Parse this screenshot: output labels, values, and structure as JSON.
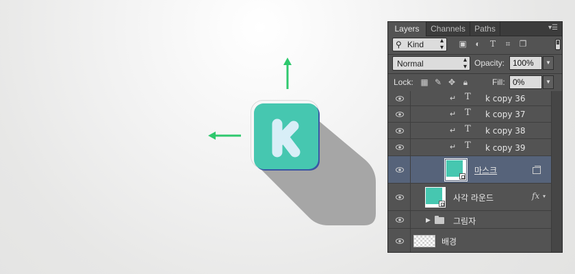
{
  "canvas": {
    "icon_letter": "K",
    "colors": {
      "arrow": "#2ec86d",
      "icon_face": "#46c7b0",
      "icon_letter": "#d8eef7",
      "shadow": "#a6a6a6",
      "icon_rim": "#3a57a4"
    },
    "arrows": [
      "arrow-up-icon",
      "arrow-left-icon"
    ]
  },
  "panel": {
    "tabs": [
      {
        "label": "Layers",
        "active": true
      },
      {
        "label": "Channels",
        "active": false
      },
      {
        "label": "Paths",
        "active": false
      }
    ],
    "menu_icon": "≡",
    "filter": {
      "kind_label": "Kind",
      "icons": [
        "image-filter-icon",
        "adjustment-filter-icon",
        "type-filter-icon",
        "shape-filter-icon",
        "smart-object-filter-icon"
      ]
    },
    "blend": {
      "mode": "Normal",
      "opacity_label": "Opacity:",
      "opacity_value": "100%"
    },
    "lock": {
      "label": "Lock:",
      "icons": [
        "lock-transparent-icon",
        "lock-paint-icon",
        "lock-move-icon",
        "lock-all-icon"
      ],
      "fill_label": "Fill:",
      "fill_value": "0%"
    },
    "layers": [
      {
        "name": "k copy 36",
        "kind": "type",
        "clipped": true
      },
      {
        "name": "k copy 37",
        "kind": "type",
        "clipped": true
      },
      {
        "name": "k copy 38",
        "kind": "type",
        "clipped": true
      },
      {
        "name": "k copy 39",
        "kind": "type",
        "clipped": true
      },
      {
        "name": "마스크",
        "kind": "shape",
        "selected": true
      },
      {
        "name": "사각 라운드",
        "kind": "shape",
        "fx": "fx"
      },
      {
        "name": "그림자",
        "kind": "group"
      },
      {
        "name": "배경",
        "kind": "background"
      }
    ],
    "type_glyph": "T",
    "clip_glyph": "↵"
  }
}
